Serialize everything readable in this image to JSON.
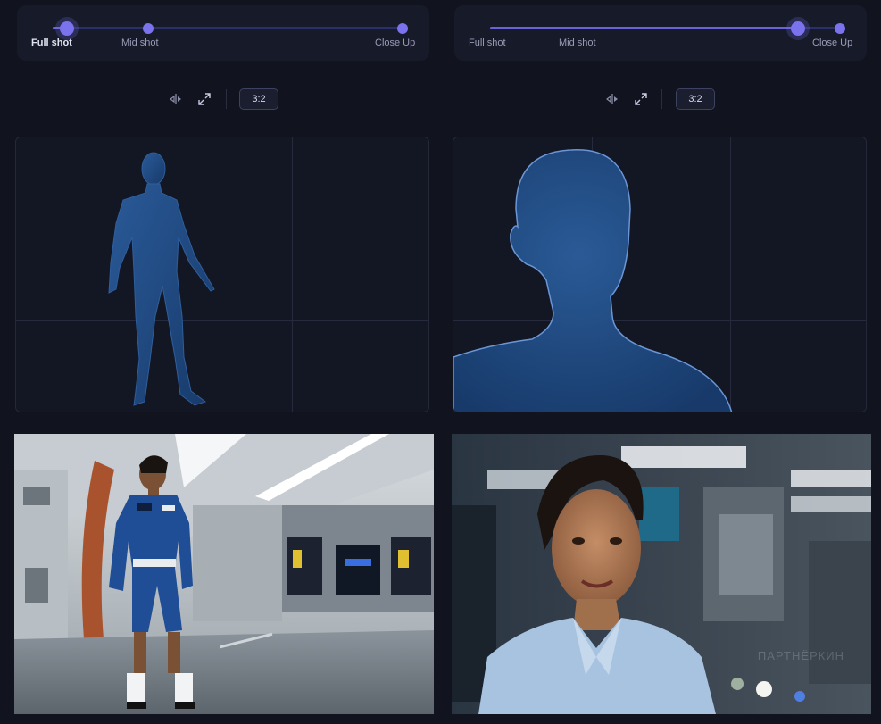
{
  "panels": [
    {
      "shot": {
        "stops": [
          "Full shot",
          "Mid shot",
          "Close Up"
        ],
        "selected": "Full shot",
        "level": 0
      },
      "toolbar": {
        "aspect_ratio": "3:2",
        "tools": [
          "flip-icon",
          "expand-icon"
        ]
      },
      "preview": {
        "framing": "full-body"
      },
      "photo": {
        "subject": "full-body"
      }
    },
    {
      "shot": {
        "stops": [
          "Full shot",
          "Mid shot",
          "Close Up"
        ],
        "selected": "Close Up",
        "level": 0.88
      },
      "toolbar": {
        "aspect_ratio": "3:2",
        "tools": [
          "flip-icon",
          "expand-icon"
        ]
      },
      "preview": {
        "framing": "head-shoulders"
      },
      "photo": {
        "subject": "close-up",
        "watermark": "ПАРТНЁРКИН"
      }
    }
  ],
  "colors": {
    "background": "#11131f",
    "accent": "#6a63d8",
    "figure": "#1f4a82",
    "figure_outline": "#5c87c9"
  }
}
